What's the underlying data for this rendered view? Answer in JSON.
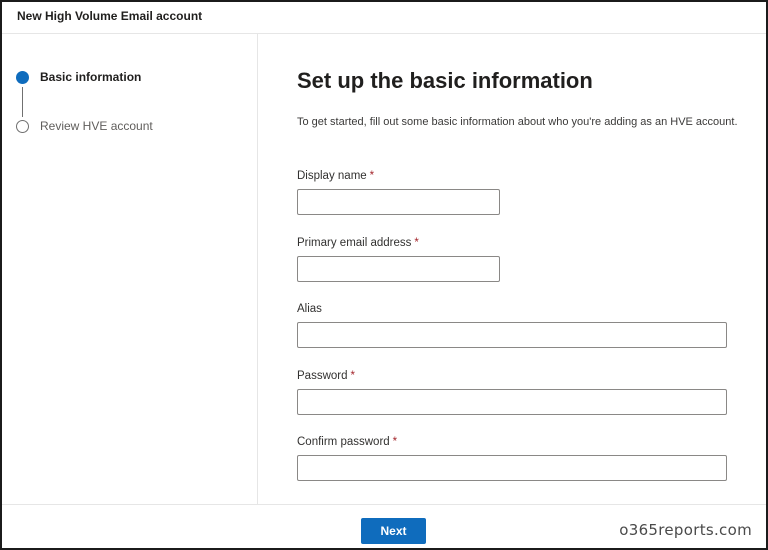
{
  "window": {
    "title": "New High Volume Email account"
  },
  "steps": [
    {
      "label": "Basic information",
      "state": "active"
    },
    {
      "label": "Review HVE account",
      "state": "inactive"
    }
  ],
  "main": {
    "heading": "Set up the basic information",
    "intro": "To get started, fill out some basic information about who you're adding as an HVE account.",
    "fields": [
      {
        "label": "Display name",
        "required": "*",
        "value": ""
      },
      {
        "label": "Primary email address",
        "required": "*",
        "value": ""
      },
      {
        "label": "Alias",
        "required": "",
        "value": ""
      },
      {
        "label": "Password",
        "required": "*",
        "value": ""
      },
      {
        "label": "Confirm password",
        "required": "*",
        "value": ""
      }
    ]
  },
  "footer": {
    "next_label": "Next",
    "watermark": "o365reports.com"
  },
  "colors": {
    "accent": "#0f6cbd",
    "required": "#a4262c"
  }
}
